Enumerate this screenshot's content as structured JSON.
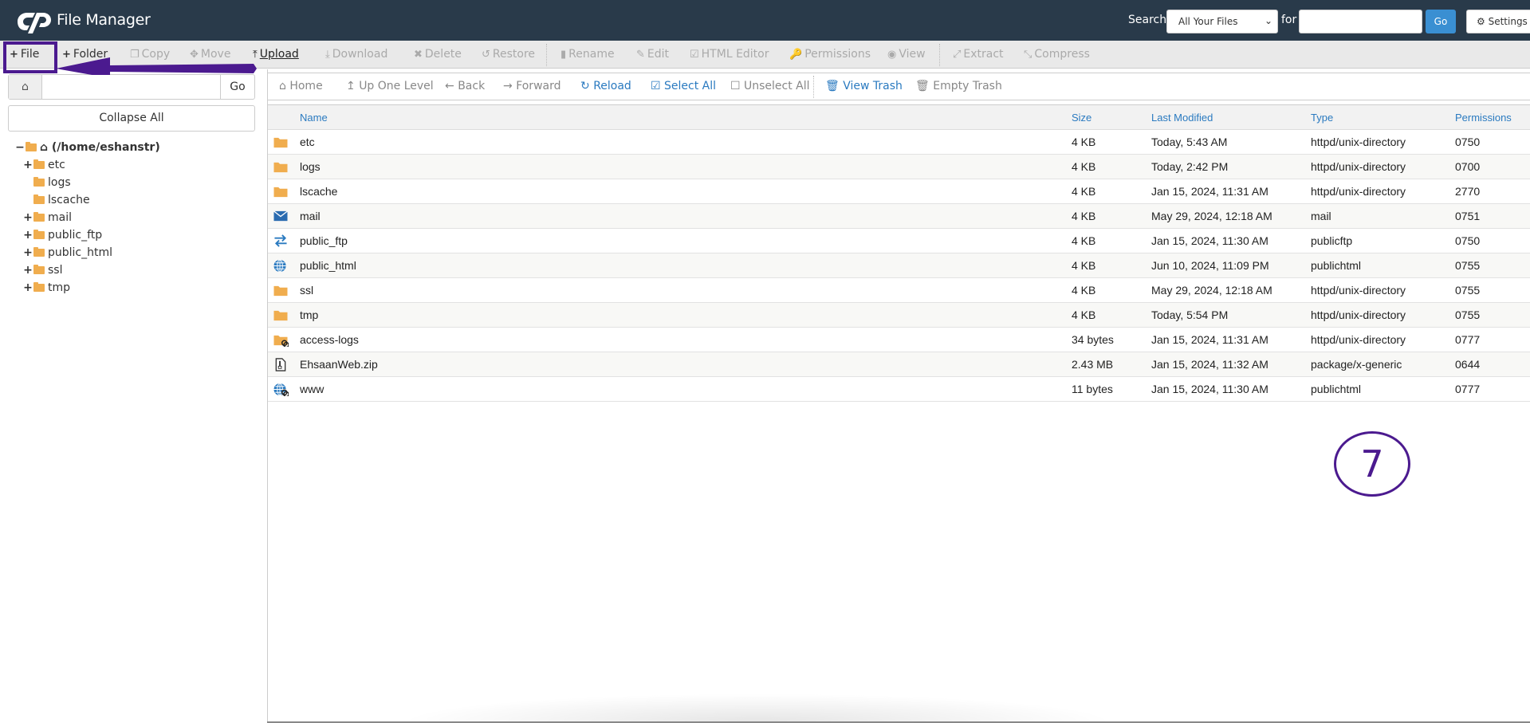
{
  "header": {
    "app_title": "File Manager",
    "search_label": "Search",
    "search_scope": "All Your Files",
    "for_label": "for",
    "search_value": "",
    "go_label": "Go",
    "settings_label": "Settings"
  },
  "toolbar": {
    "items": [
      {
        "label": "File",
        "icon": "plus-icon",
        "enabled": true
      },
      {
        "label": "Folder",
        "icon": "plus-icon",
        "enabled": true
      },
      {
        "label": "Copy",
        "icon": "copy-icon",
        "enabled": false
      },
      {
        "label": "Move",
        "icon": "move-icon",
        "enabled": false
      },
      {
        "label": "Upload",
        "icon": "upload-icon",
        "enabled": true
      },
      {
        "label": "Download",
        "icon": "download-icon",
        "enabled": false
      },
      {
        "label": "Delete",
        "icon": "delete-icon",
        "enabled": false
      },
      {
        "label": "Restore",
        "icon": "restore-icon",
        "enabled": false
      },
      {
        "label": "Rename",
        "icon": "file-icon",
        "enabled": false
      },
      {
        "label": "Edit",
        "icon": "pencil-icon",
        "enabled": false
      },
      {
        "label": "HTML Editor",
        "icon": "edit-square-icon",
        "enabled": false
      },
      {
        "label": "Permissions",
        "icon": "key-icon",
        "enabled": false
      },
      {
        "label": "View",
        "icon": "eye-icon",
        "enabled": false
      },
      {
        "label": "Extract",
        "icon": "expand-icon",
        "enabled": false
      },
      {
        "label": "Compress",
        "icon": "compress-icon",
        "enabled": false
      }
    ]
  },
  "left": {
    "path_value": "",
    "go_label": "Go",
    "collapse_label": "Collapse All",
    "tree_root": "(/home/eshanstr)",
    "tree": [
      {
        "label": "etc",
        "expandable": true
      },
      {
        "label": "logs",
        "expandable": false
      },
      {
        "label": "lscache",
        "expandable": false
      },
      {
        "label": "mail",
        "expandable": true
      },
      {
        "label": "public_ftp",
        "expandable": true
      },
      {
        "label": "public_html",
        "expandable": true
      },
      {
        "label": "ssl",
        "expandable": true
      },
      {
        "label": "tmp",
        "expandable": true
      }
    ]
  },
  "nav": {
    "home": "Home",
    "up": "Up One Level",
    "back": "Back",
    "forward": "Forward",
    "reload": "Reload",
    "select_all": "Select All",
    "unselect_all": "Unselect All",
    "view_trash": "View Trash",
    "empty_trash": "Empty Trash"
  },
  "table": {
    "columns": [
      "Name",
      "Size",
      "Last Modified",
      "Type",
      "Permissions"
    ],
    "rows": [
      {
        "icon": "folder-icon",
        "name": "etc",
        "size": "4 KB",
        "modified": "Today, 5:43 AM",
        "type": "httpd/unix-directory",
        "perms": "0750"
      },
      {
        "icon": "folder-icon",
        "name": "logs",
        "size": "4 KB",
        "modified": "Today, 2:42 PM",
        "type": "httpd/unix-directory",
        "perms": "0700"
      },
      {
        "icon": "folder-icon",
        "name": "lscache",
        "size": "4 KB",
        "modified": "Jan 15, 2024, 11:31 AM",
        "type": "httpd/unix-directory",
        "perms": "2770"
      },
      {
        "icon": "mail-icon",
        "name": "mail",
        "size": "4 KB",
        "modified": "May 29, 2024, 12:18 AM",
        "type": "mail",
        "perms": "0751"
      },
      {
        "icon": "transfer-icon",
        "name": "public_ftp",
        "size": "4 KB",
        "modified": "Jan 15, 2024, 11:30 AM",
        "type": "publicftp",
        "perms": "0750"
      },
      {
        "icon": "globe-icon",
        "name": "public_html",
        "size": "4 KB",
        "modified": "Jun 10, 2024, 11:09 PM",
        "type": "publichtml",
        "perms": "0755"
      },
      {
        "icon": "folder-icon",
        "name": "ssl",
        "size": "4 KB",
        "modified": "May 29, 2024, 12:18 AM",
        "type": "httpd/unix-directory",
        "perms": "0755"
      },
      {
        "icon": "folder-icon",
        "name": "tmp",
        "size": "4 KB",
        "modified": "Today, 5:54 PM",
        "type": "httpd/unix-directory",
        "perms": "0755"
      },
      {
        "icon": "folder-link-icon",
        "name": "access-logs",
        "size": "34 bytes",
        "modified": "Jan 15, 2024, 11:31 AM",
        "type": "httpd/unix-directory",
        "perms": "0777"
      },
      {
        "icon": "zip-file-icon",
        "name": "EhsaanWeb.zip",
        "size": "2.43 MB",
        "modified": "Jan 15, 2024, 11:32 AM",
        "type": "package/x-generic",
        "perms": "0644"
      },
      {
        "icon": "globe-link-icon",
        "name": "www",
        "size": "11 bytes",
        "modified": "Jan 15, 2024, 11:30 AM",
        "type": "publichtml",
        "perms": "0777"
      }
    ]
  },
  "annotation": {
    "step_number": "7",
    "color": "#4b1a8f"
  },
  "colors": {
    "header_bg": "#293a4a",
    "accent_blue": "#2a7ac0",
    "go_button": "#3a8fd2",
    "folder": "#f0ad4e"
  }
}
